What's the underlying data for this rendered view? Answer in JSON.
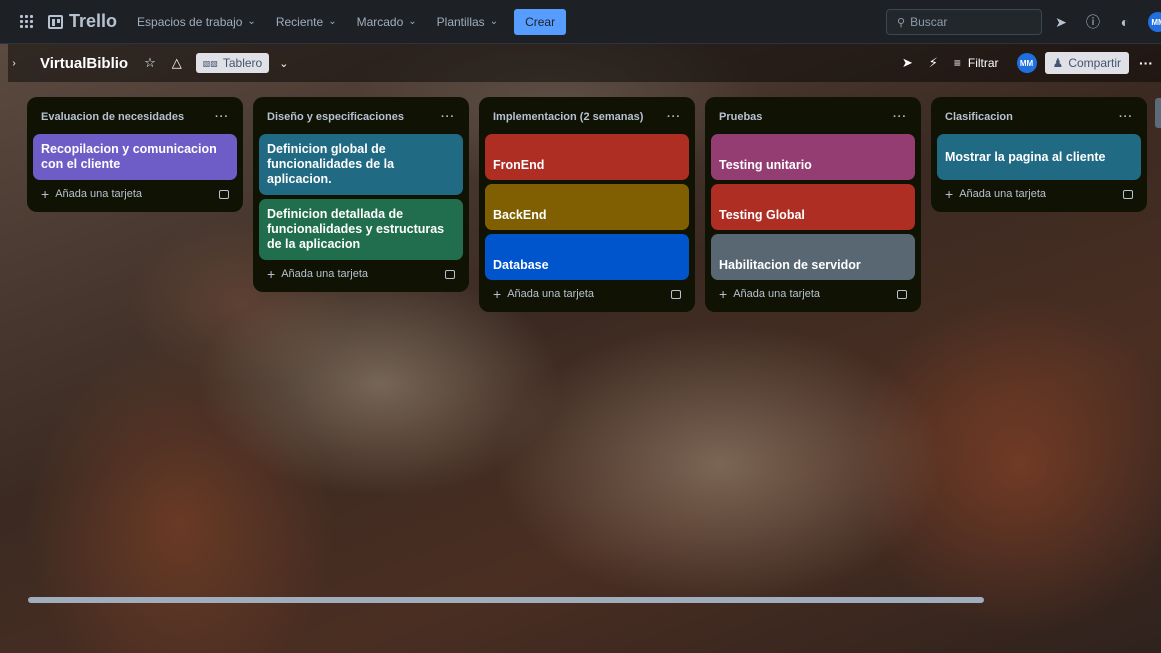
{
  "topbar": {
    "app_name": "Trello",
    "nav": [
      {
        "label": "Espacios de trabajo"
      },
      {
        "label": "Reciente"
      },
      {
        "label": "Marcado"
      },
      {
        "label": "Plantillas"
      }
    ],
    "create_label": "Crear",
    "search_placeholder": "Buscar",
    "avatar_initials": "MM",
    "icons": [
      "apps-grid-icon",
      "notifications-icon",
      "help-icon",
      "theme-icon"
    ]
  },
  "board": {
    "title": "VirtualBiblio",
    "view_label": "Tablero",
    "filter_label": "Filtrar",
    "member_initials": "MM",
    "share_label": "Compartir"
  },
  "lists": [
    {
      "title": "Evaluacion de necesidades",
      "cards": [
        {
          "text": "Recopilacion y comunicacion con el cliente",
          "color": "#6e5dc6"
        }
      ],
      "add_label": "Añada una tarjeta"
    },
    {
      "title": "Diseño y especificaciones",
      "cards": [
        {
          "text": "Definicion global de funcionalidades de la aplicacion.",
          "color": "#206a83"
        },
        {
          "text": "Definicion detallada de funcionalidades y estructuras de la aplicacion",
          "color": "#216e4e"
        }
      ],
      "add_label": "Añada una tarjeta"
    },
    {
      "title": "Implementacion (2 semanas)",
      "cards": [
        {
          "text": "FronEnd",
          "color": "#ae2e24"
        },
        {
          "text": "BackEnd",
          "color": "#7f5f01"
        },
        {
          "text": "Database",
          "color": "#0055cc"
        }
      ],
      "add_label": "Añada una tarjeta"
    },
    {
      "title": "Pruebas",
      "cards": [
        {
          "text": "Testing unitario",
          "color": "#943d73"
        },
        {
          "text": "Testing Global",
          "color": "#ae2e24"
        },
        {
          "text": "Habilitacion de servidor",
          "color": "#596773"
        }
      ],
      "add_label": "Añada una tarjeta"
    },
    {
      "title": "Clasificacion",
      "cards": [
        {
          "text": "Mostrar la pagina al cliente",
          "color": "#206a83"
        }
      ],
      "add_label": "Añada una tarjeta"
    }
  ]
}
